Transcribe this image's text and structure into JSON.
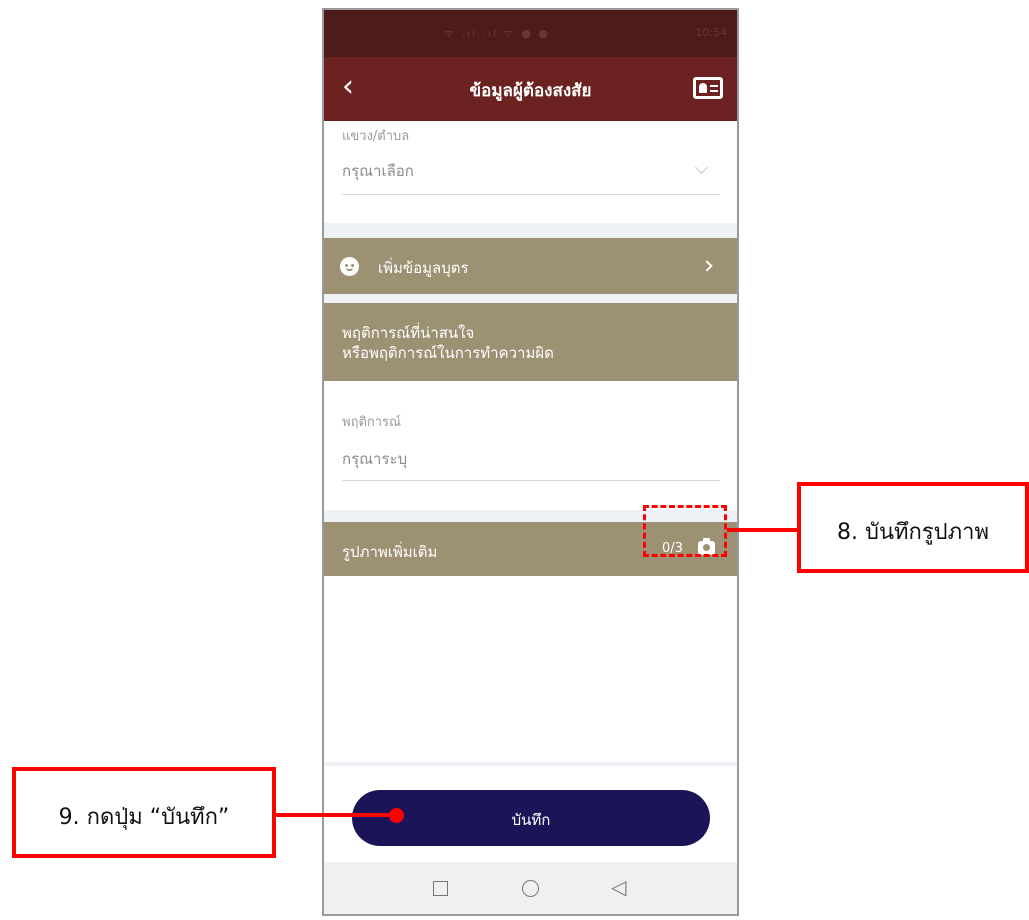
{
  "app": {
    "title": "ข้อมูลผู้ต้องสงสัย"
  },
  "statusbar": {
    "icons_text": "ᯤ .ıl .ıl ᯤ ● ●",
    "time": "10:54"
  },
  "form": {
    "subdistrict_label": "แขวง/ตำบล",
    "subdistrict_value": "กรุณาเลือก",
    "add_child_label": "เพิ่มข้อมูลบุตร",
    "behavior_section_line1": "พฤติการณ์ที่น่าสนใจ",
    "behavior_section_line2": "หรือพฤติการณ์ในการทำความผิด",
    "behavior_label": "พฤติการณ์",
    "behavior_placeholder": "กรุณาระบุ",
    "photos_label": "รูปภาพเพิ่มเติม",
    "photos_count": "0/3"
  },
  "actions": {
    "save_label": "บันทึก"
  },
  "navbar": {
    "back_glyph": "◁"
  },
  "annotations": {
    "photo_callout": "8. บันทึกรูปภาพ",
    "save_callout": "9. กดปุ่ม “บันทึก”"
  },
  "colors": {
    "appbar": "#6b2221",
    "statusbar": "#4d1b19",
    "section_tan": "#9d9173",
    "save_button": "#1b1458",
    "callout_red": "#ff0000"
  },
  "icons": [
    "back-arrow-icon",
    "id-card-icon",
    "chevron-down-icon",
    "child-face-icon",
    "chevron-right-icon",
    "camera-icon",
    "nav-recent-icon",
    "nav-home-icon",
    "nav-back-icon"
  ]
}
